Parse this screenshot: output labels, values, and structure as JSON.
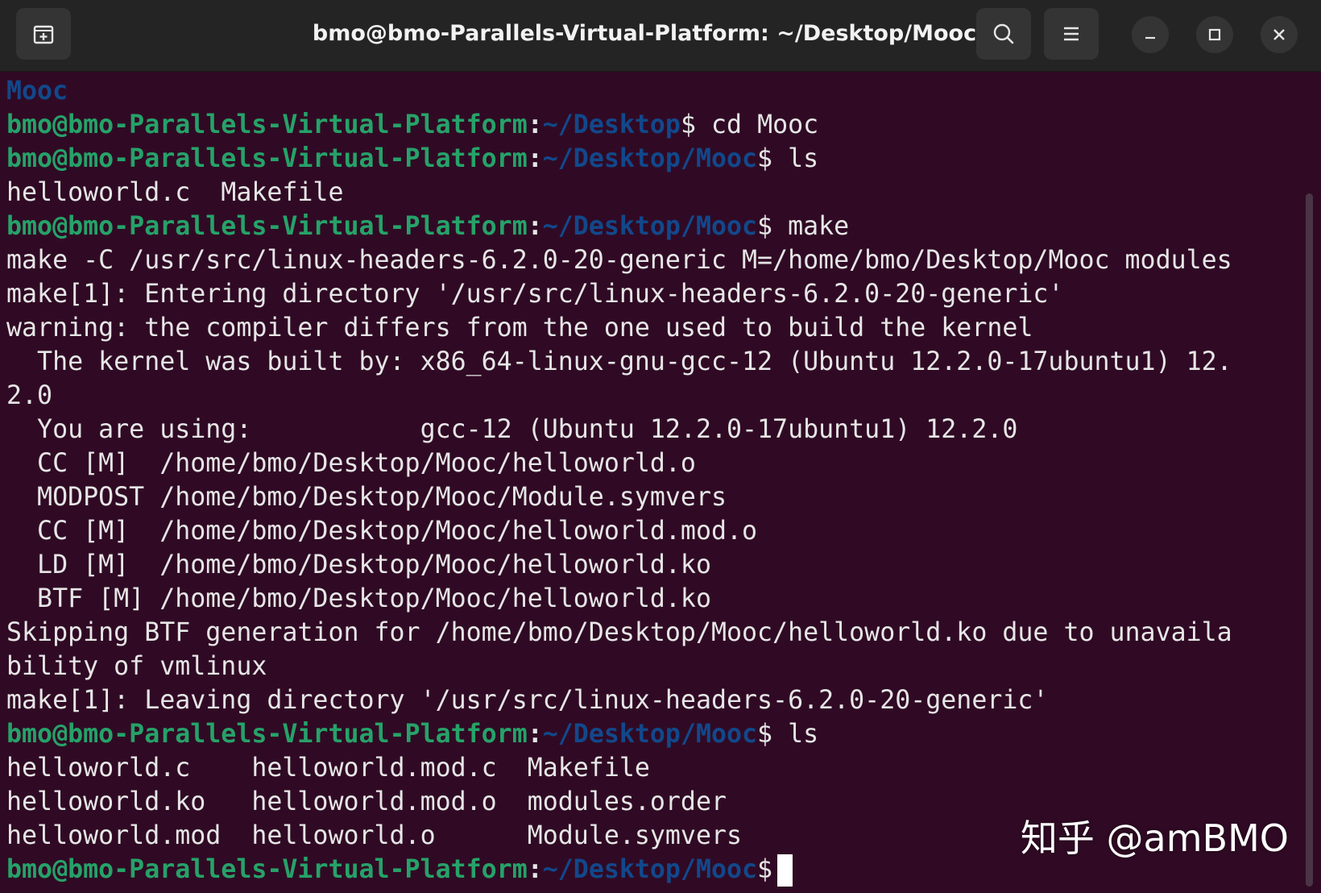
{
  "window": {
    "title": "bmo@bmo-Parallels-Virtual-Platform: ~/Desktop/Mooc",
    "new_tab_icon": "new-tab-icon",
    "search_icon": "search-icon",
    "menu_icon": "hamburger-menu-icon",
    "minimize_icon": "minimize-icon",
    "maximize_icon": "maximize-icon",
    "close_icon": "close-icon"
  },
  "colors": {
    "terminal_bg": "#300a24",
    "prompt_user": "#26a269",
    "prompt_path": "#12488b",
    "text": "#e6e6e6",
    "titlebar": "#242424"
  },
  "terminal": {
    "prompt_user": "bmo@bmo-Parallels-Virtual-Platform",
    "prompt_colon": ":",
    "dollar": "$",
    "lines": {
      "l0": "Mooc",
      "p1_path": "~/Desktop",
      "p1_cmd": " cd Mooc",
      "p2_path": "~/Desktop/Mooc",
      "p2_cmd": " ls",
      "l3": "helloworld.c  Makefile",
      "p4_path": "~/Desktop/Mooc",
      "p4_cmd": " make",
      "l5": "make -C /usr/src/linux-headers-6.2.0-20-generic M=/home/bmo/Desktop/Mooc modules",
      "l6": "make[1]: Entering directory '/usr/src/linux-headers-6.2.0-20-generic'",
      "l7": "warning: the compiler differs from the one used to build the kernel",
      "l8": "  The kernel was built by: x86_64-linux-gnu-gcc-12 (Ubuntu 12.2.0-17ubuntu1) 12.",
      "l9": "2.0",
      "l10": "  You are using:           gcc-12 (Ubuntu 12.2.0-17ubuntu1) 12.2.0",
      "l11": "  CC [M]  /home/bmo/Desktop/Mooc/helloworld.o",
      "l12": "  MODPOST /home/bmo/Desktop/Mooc/Module.symvers",
      "l13": "  CC [M]  /home/bmo/Desktop/Mooc/helloworld.mod.o",
      "l14": "  LD [M]  /home/bmo/Desktop/Mooc/helloworld.ko",
      "l15": "  BTF [M] /home/bmo/Desktop/Mooc/helloworld.ko",
      "l16": "Skipping BTF generation for /home/bmo/Desktop/Mooc/helloworld.ko due to unavaila",
      "l17": "bility of vmlinux",
      "l18": "make[1]: Leaving directory '/usr/src/linux-headers-6.2.0-20-generic'",
      "p19_path": "~/Desktop/Mooc",
      "p19_cmd": " ls",
      "l20": "helloworld.c    helloworld.mod.c  Makefile",
      "l21": "helloworld.ko   helloworld.mod.o  modules.order",
      "l22": "helloworld.mod  helloworld.o      Module.symvers",
      "p23_path": "~/Desktop/Mooc",
      "p23_cmd": " "
    }
  },
  "watermark": "知乎 @amBMO"
}
